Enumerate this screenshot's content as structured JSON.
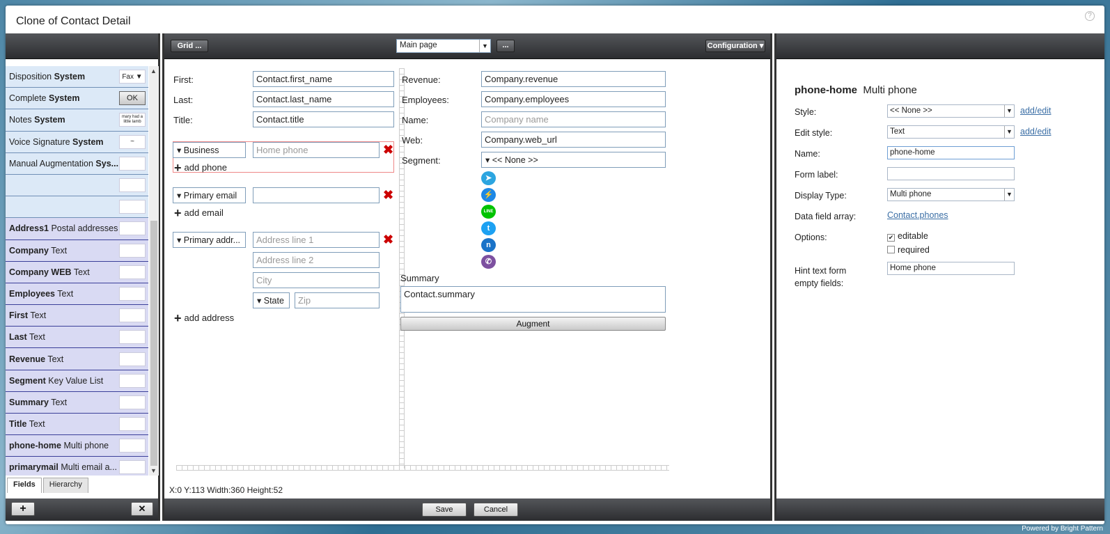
{
  "dialog": {
    "title": "Clone of Contact Detail",
    "help": "?"
  },
  "left": {
    "fields": [
      {
        "name": "Disposition",
        "type": "System",
        "preview": "Fax ▼",
        "kind": "sys"
      },
      {
        "name": "Complete",
        "type": "System",
        "preview": "OK",
        "kind": "sys"
      },
      {
        "name": "Notes",
        "type": "System",
        "preview": "mary had a little lamb",
        "kind": "sys"
      },
      {
        "name": "Voice Signature",
        "type": "System",
        "preview": "~",
        "kind": "sys"
      },
      {
        "name": "Manual Augmentation",
        "type": "Sys...",
        "preview": "",
        "kind": "sys"
      },
      {
        "name": "",
        "type": "",
        "preview": "",
        "kind": "sys"
      },
      {
        "name": "",
        "type": "",
        "preview": "",
        "kind": "sys"
      },
      {
        "name": "Address1",
        "type": "Postal addresses",
        "preview": "",
        "kind": "fld"
      },
      {
        "name": "Company",
        "type": "Text",
        "preview": "",
        "kind": "fld"
      },
      {
        "name": "Company WEB",
        "type": "Text",
        "preview": "",
        "kind": "fld"
      },
      {
        "name": "Employees",
        "type": "Text",
        "preview": "",
        "kind": "fld"
      },
      {
        "name": "First",
        "type": "Text",
        "preview": "",
        "kind": "fld"
      },
      {
        "name": "Last",
        "type": "Text",
        "preview": "",
        "kind": "fld"
      },
      {
        "name": "Revenue",
        "type": "Text",
        "preview": "",
        "kind": "fld"
      },
      {
        "name": "Segment",
        "type": "Key Value List",
        "preview": "",
        "kind": "fld"
      },
      {
        "name": "Summary",
        "type": "Text",
        "preview": "",
        "kind": "fld"
      },
      {
        "name": "Title",
        "type": "Text",
        "preview": "",
        "kind": "fld"
      },
      {
        "name": "phone-home",
        "type": "Multi phone",
        "preview": "",
        "kind": "fld"
      },
      {
        "name": "primarymail",
        "type": "Multi email a...",
        "preview": "",
        "kind": "fld"
      }
    ],
    "tabs": [
      "Fields",
      "Hierarchy"
    ],
    "add_label": "+",
    "remove_label": "✕"
  },
  "center": {
    "grid_label": "Grid ...",
    "page_select": "Main page",
    "more_label": "...",
    "config_label": "Configuration",
    "labels": {
      "first": "First:",
      "last": "Last:",
      "title": "Title:",
      "revenue": "Revenue:",
      "employees": "Employees:",
      "name": "Name:",
      "web": "Web:",
      "segment": "Segment:",
      "summary": "Summary"
    },
    "values": {
      "first": "Contact.first_name",
      "last": "Contact.last_name",
      "title": "Contact.title",
      "revenue": "Company.revenue",
      "employees": "Company.employees",
      "name": "Company name",
      "web": "Company.web_url",
      "segment": "▾ << None >>",
      "summary": "Contact.summary"
    },
    "phone": {
      "type": "▾ Business",
      "placeholder": "Home phone",
      "add": "add phone"
    },
    "email": {
      "type": "▾ Primary email",
      "value": "",
      "add": "add email"
    },
    "address": {
      "type": "▾ Primary addr...",
      "line1": "Address line 1",
      "line2": "Address line 2",
      "city": "City",
      "state": "▾ State",
      "zip": "Zip",
      "add": "add address"
    },
    "augment_label": "Augment",
    "status": "X:0 Y:113 Width:360 Height:52",
    "save_label": "Save",
    "cancel_label": "Cancel",
    "social_icons": [
      {
        "name": "telegram-icon",
        "color": "#2ca5e0",
        "glyph": "➤"
      },
      {
        "name": "messenger-icon",
        "color": "#1e88e5",
        "glyph": "⚡"
      },
      {
        "name": "line-icon",
        "color": "#00c300",
        "glyph": "LINE"
      },
      {
        "name": "twitter-icon",
        "color": "#1da1f2",
        "glyph": "t"
      },
      {
        "name": "nextiva-icon",
        "color": "#1a73c8",
        "glyph": "n"
      },
      {
        "name": "viber-icon",
        "color": "#7d50a0",
        "glyph": "✆"
      }
    ]
  },
  "right": {
    "heading_name": "phone-home",
    "heading_type": "Multi phone",
    "style_label": "Style:",
    "style_value": "<< None >>",
    "edit_style_label": "Edit style:",
    "edit_style_value": "Text",
    "add_edit": "add/edit",
    "name_label": "Name:",
    "name_value": "phone-home",
    "form_label_label": "Form label:",
    "form_label_value": "",
    "display_type_label": "Display Type:",
    "display_type_value": "Multi phone",
    "data_field_label": "Data field array:",
    "data_field_value": "Contact.phones",
    "options_label": "Options:",
    "opt_editable": "editable",
    "opt_required": "required",
    "hint_label": "Hint text form empty fields:",
    "hint_value": "Home phone"
  },
  "footer": {
    "powered": "Powered by Bright Pattern"
  }
}
